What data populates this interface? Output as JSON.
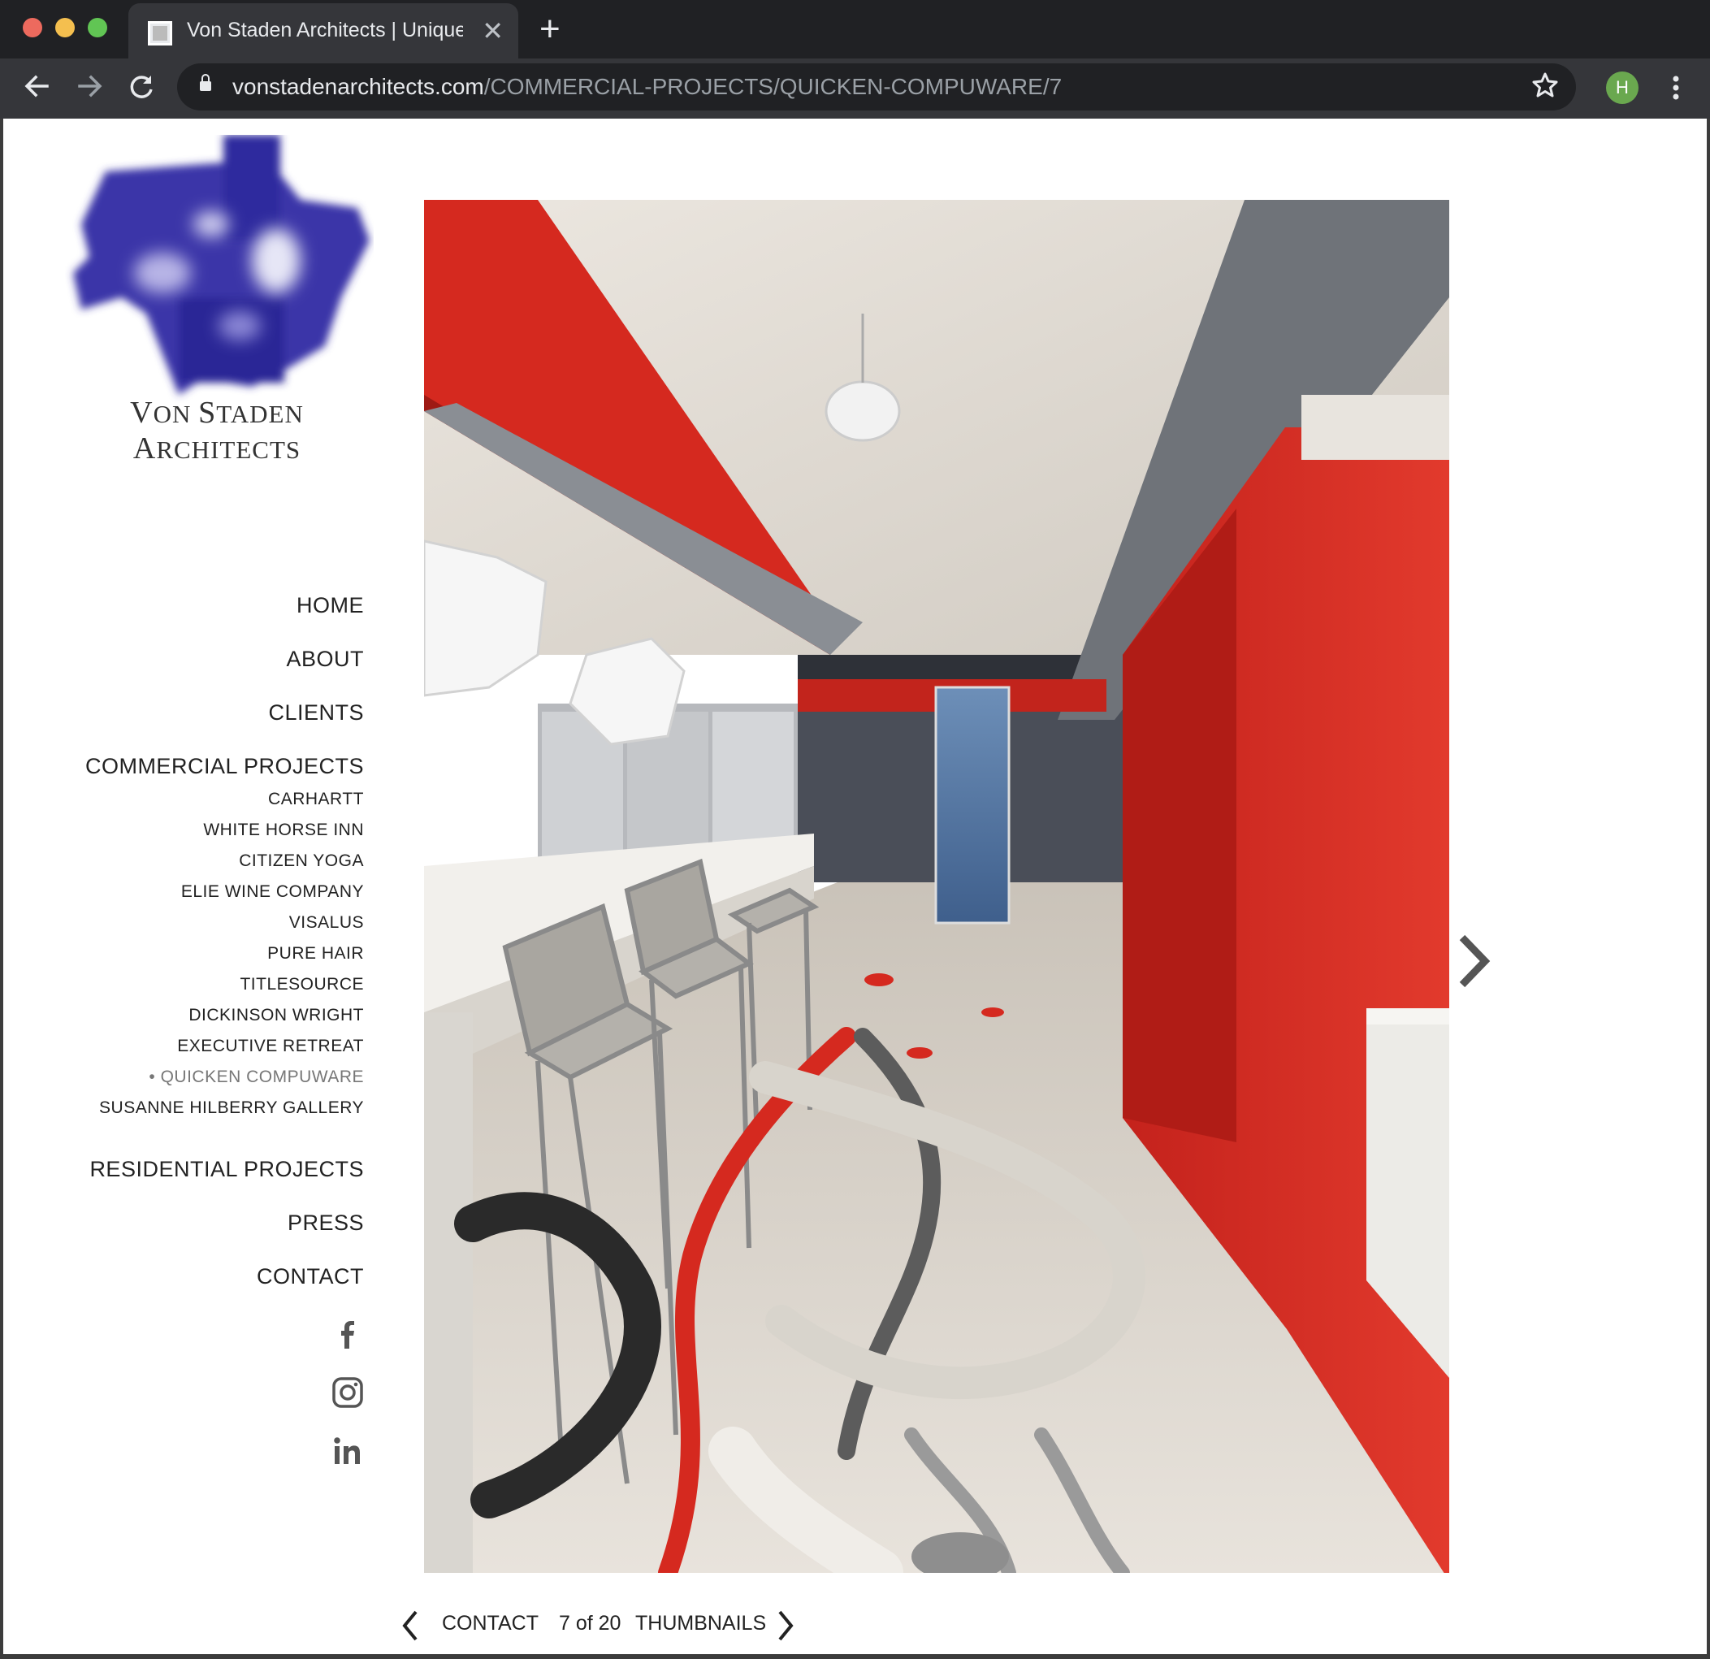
{
  "browser": {
    "tab_title": "Von Staden Architects | Unique",
    "tab_close": "✕",
    "new_tab": "+",
    "url_host": "vonstadenarchitects.com",
    "url_path": "/COMMERCIAL-PROJECTS/QUICKEN-COMPUWARE/7",
    "profile_initial": "H",
    "accent_colors": {
      "close": "#ed6a5e",
      "minimize": "#f4bf4f",
      "zoom": "#61c554",
      "profile": "#6aa84f"
    }
  },
  "site": {
    "logo_text": {
      "first_v": "V",
      "on": "ON ",
      "first_s": "S",
      "taden": "TADEN ",
      "first_a": "A",
      "rchitects": "RCHITECTS"
    },
    "logo_color": "#3a35a8"
  },
  "nav": {
    "main": [
      {
        "label": "HOME"
      },
      {
        "label": "ABOUT"
      },
      {
        "label": "CLIENTS"
      },
      {
        "label": "COMMERCIAL PROJECTS"
      }
    ],
    "commercial_sub": [
      {
        "label": "CARHARTT"
      },
      {
        "label": "WHITE HORSE INN"
      },
      {
        "label": "CITIZEN YOGA"
      },
      {
        "label": "ELIE WINE COMPANY"
      },
      {
        "label": "VISALUS"
      },
      {
        "label": "PURE HAIR"
      },
      {
        "label": "TITLESOURCE"
      },
      {
        "label": "DICKINSON WRIGHT"
      },
      {
        "label": "EXECUTIVE RETREAT"
      },
      {
        "label": "• QUICKEN COMPUWARE",
        "active": true
      },
      {
        "label": "SUSANNE HILBERRY GALLERY"
      }
    ],
    "after": [
      {
        "label": "RESIDENTIAL PROJECTS"
      },
      {
        "label": "PRESS"
      },
      {
        "label": "CONTACT"
      }
    ],
    "social": [
      {
        "icon": "facebook-icon",
        "glyph": "f"
      },
      {
        "icon": "instagram-icon"
      },
      {
        "icon": "linkedin-icon",
        "glyph": "in"
      }
    ]
  },
  "gallery": {
    "pager_contact": "CONTACT",
    "pager_count": "7 of 20",
    "pager_thumbnails": "THUMBNAILS"
  }
}
